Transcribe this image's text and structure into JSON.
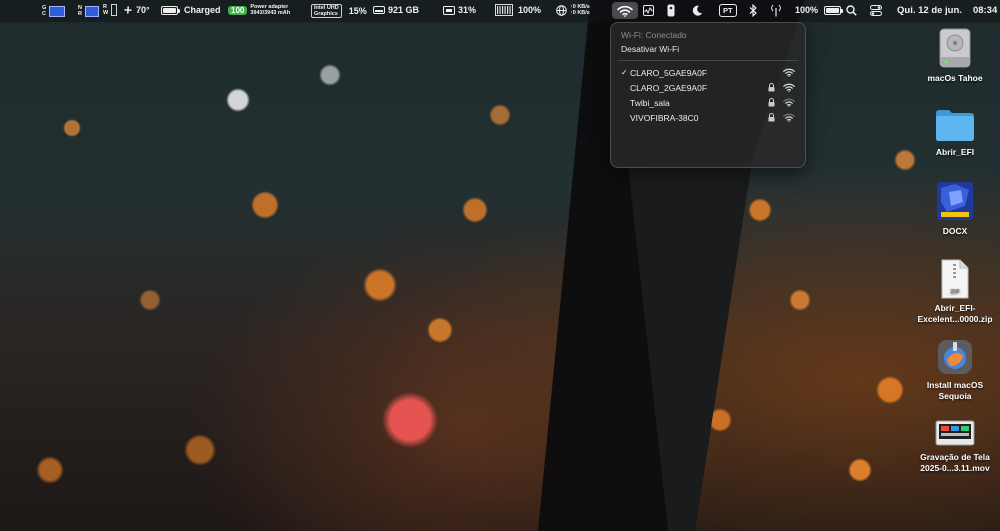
{
  "menubar": {
    "temperature": "70°",
    "battery_status": "Charged",
    "power_badge": "100",
    "power_adapter_line1": "Power adapter",
    "power_adapter_line2": "3943/3943 mAh",
    "gpu_label_line1": "Intel UHD",
    "gpu_label_line2": "Graphics",
    "gpu_percent": "15%",
    "disk_free": "921 GB",
    "cpu_percent": "31%",
    "memory_percent": "100%",
    "net_up": "↑0 KB/s",
    "net_down": "↑0 KB/s",
    "input_source": "PT",
    "battery_percent": "100%",
    "date": "Qui. 12 de jun.",
    "time": "08:34"
  },
  "wifi_menu": {
    "status": "Wi-Fi: Conectado",
    "toggle_label": "Desativar Wi-Fi",
    "networks": [
      {
        "name": "CLARO_5GAE9A0F",
        "connected": true,
        "locked": false
      },
      {
        "name": "CLARO_2GAE9A0F",
        "connected": false,
        "locked": true
      },
      {
        "name": "Twibi_sala",
        "connected": false,
        "locked": true
      },
      {
        "name": "VIVOFIBRA-38C0",
        "connected": false,
        "locked": true
      }
    ],
    "check_mark": "✓"
  },
  "desktop_icons": [
    {
      "label_line1": "macOs Tahoe",
      "label_line2": "",
      "icon": "hard-drive-icon"
    },
    {
      "label_line1": "Abrir_EFI",
      "label_line2": "",
      "icon": "folder-icon"
    },
    {
      "label_line1": "DOCX",
      "label_line2": "",
      "icon": "app-icon"
    },
    {
      "label_line1": "Abrir_EFI-",
      "label_line2": "Excelent...0000.zip",
      "icon": "zip-file-icon"
    },
    {
      "label_line1": "Install macOS",
      "label_line2": "Sequoia",
      "icon": "installer-icon"
    },
    {
      "label_line1": "Gravação de Tela",
      "label_line2": "2025-0...3.11.mov",
      "icon": "video-file-icon"
    }
  ],
  "colors": {
    "menubar_bg": "#121418",
    "accent_green": "#3fb24a",
    "folder_blue": "#4aa8e8",
    "docx_blue": "#1f3a9a"
  }
}
